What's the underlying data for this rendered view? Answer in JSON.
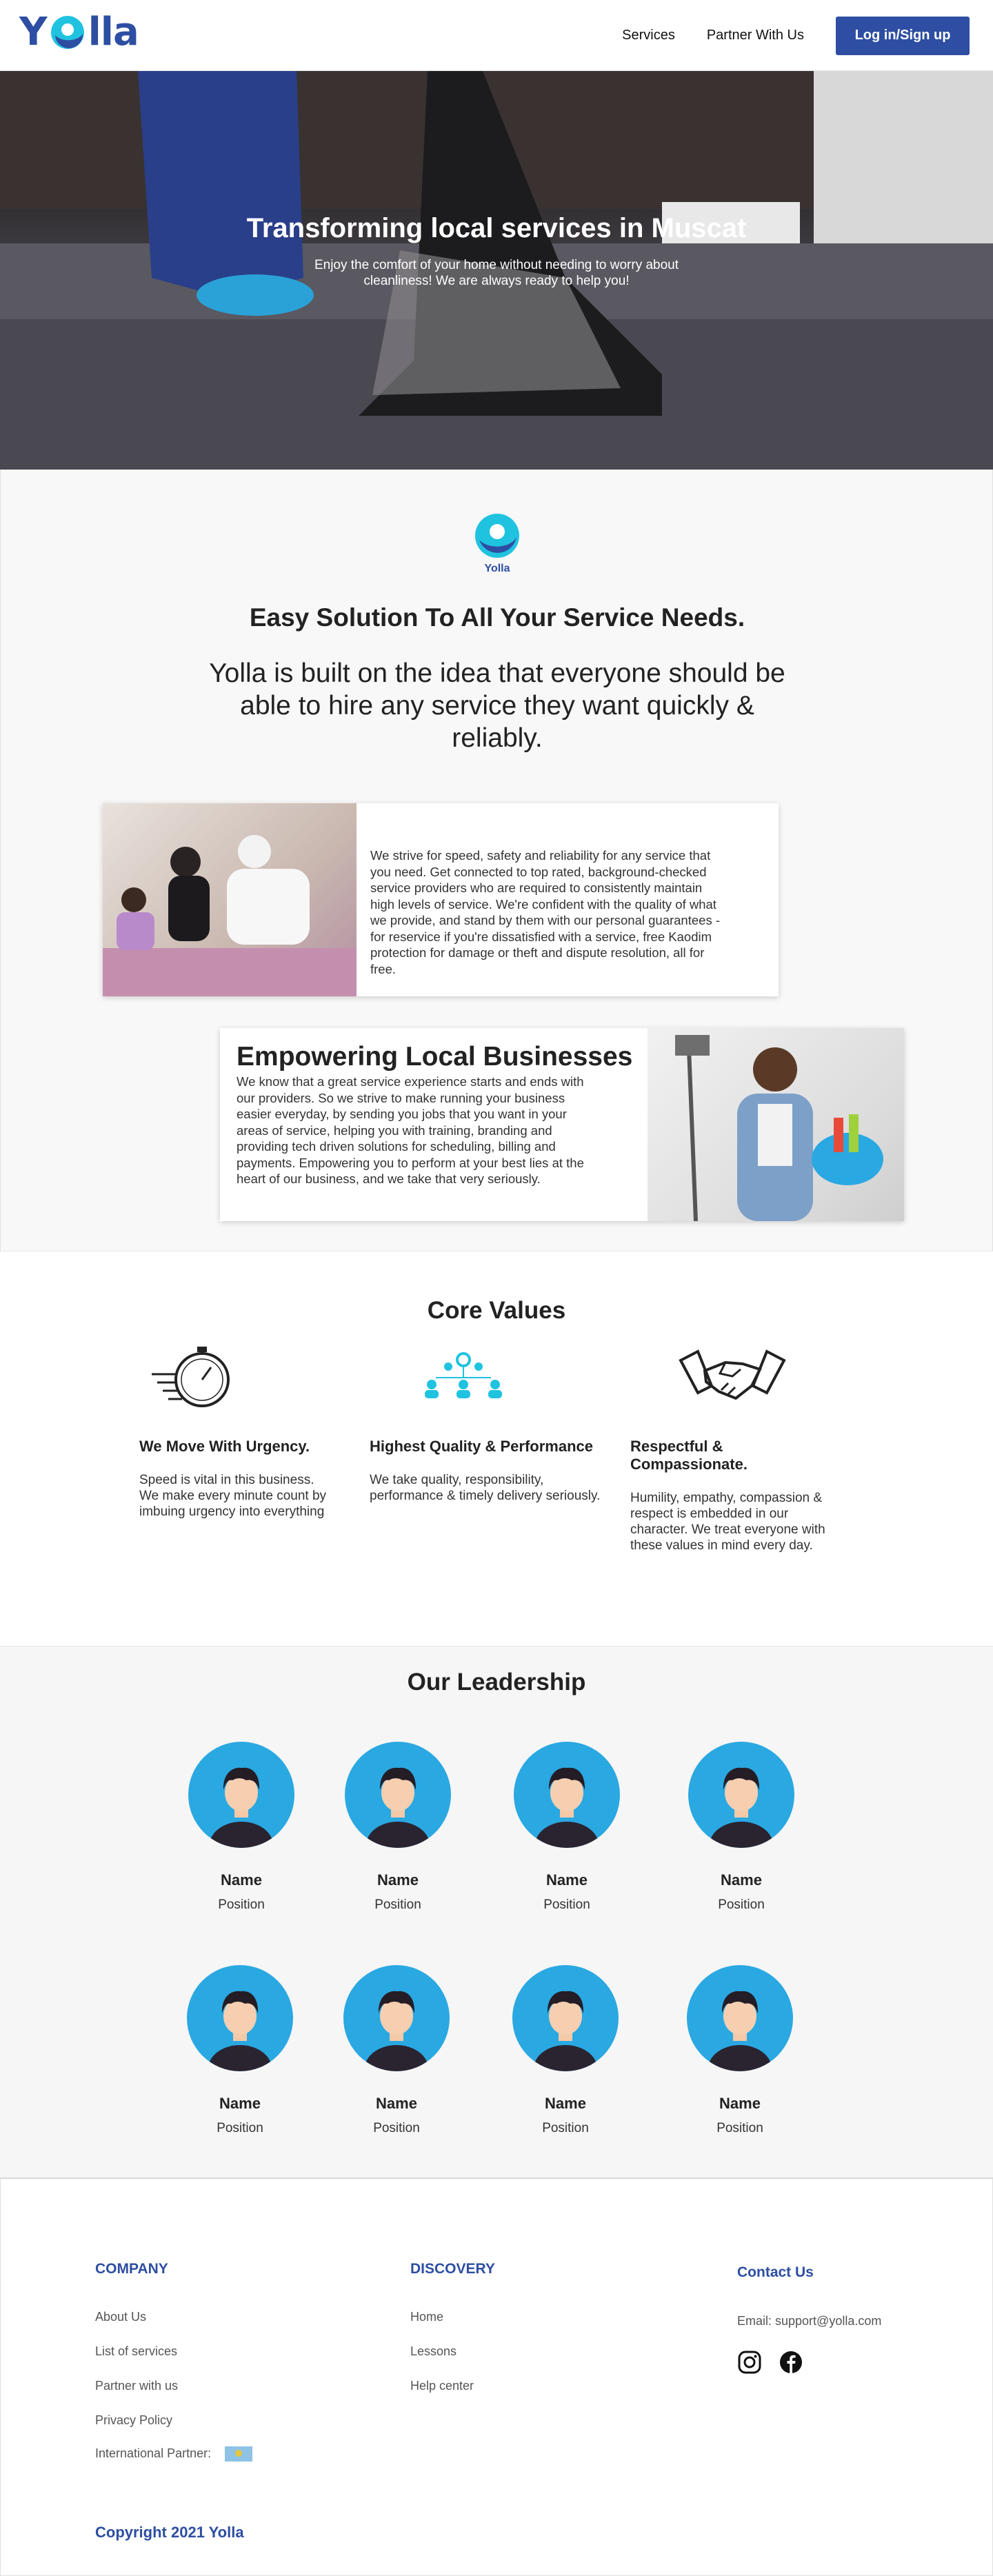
{
  "header": {
    "logo": "Yolla",
    "nav": [
      "Services",
      "Partner With Us"
    ],
    "login_label": "Log in/Sign up"
  },
  "hero": {
    "title": "Transforming local services in Muscat",
    "subtitle": "Enjoy the comfort of your home without needing to worry about cleanliness! We are always ready to help you!"
  },
  "intro": {
    "logo_caption": "Yolla",
    "heading": "Easy Solution To All Your Service Needs.",
    "paragraph": "Yolla is built on the idea that everyone should be able to hire any service they want quickly & reliably.",
    "card1_text": "We strive for speed, safety and reliability for any service that you need. Get connected to top rated, background-checked service providers who are required to consistently maintain high levels of service. We're confident with the quality of what we provide, and stand by them with our personal guarantees - for reservice if you're dissatisfied with a service, free Kaodim protection for damage or theft and dispute resolution, all for free.",
    "card2_title": "Empowering Local Businesses",
    "card2_text": "We know that a great service experience starts and ends with our providers. So we strive to make running your business easier everyday, by sending you jobs that you want in your areas of service, helping you with training, branding and providing tech driven solutions for scheduling, billing and payments. Empowering you to perform at your best lies at the heart of our business, and we take that very seriously."
  },
  "core_values": {
    "title": "Core Values",
    "items": [
      {
        "title": "We Move With Urgency.",
        "desc": "Speed is vital in this business. We make every minute count by imbuing urgency into everything",
        "icon": "stopwatch-icon"
      },
      {
        "title": "Highest Quality & Performance",
        "desc": "We take quality, responsibility, performance & timely delivery seriously.",
        "icon": "team-network-icon"
      },
      {
        "title": "Respectful & Compassionate.",
        "desc": "Humility, empathy, compassion & respect is embedded in our character. We treat everyone with these values in mind every day.",
        "icon": "handshake-icon"
      }
    ]
  },
  "leadership": {
    "title": "Our Leadership",
    "members": [
      {
        "name": "Name",
        "position": "Position"
      },
      {
        "name": "Name",
        "position": "Position"
      },
      {
        "name": "Name",
        "position": "Position"
      },
      {
        "name": "Name",
        "position": "Position"
      },
      {
        "name": "Name",
        "position": "Position"
      },
      {
        "name": "Name",
        "position": "Position"
      },
      {
        "name": "Name",
        "position": "Position"
      },
      {
        "name": "Name",
        "position": "Position"
      }
    ]
  },
  "footer": {
    "company_title": "COMPANY",
    "company_links": [
      "About Us",
      "List of services",
      "Partner with us",
      "Privacy Policy",
      "International Partner:"
    ],
    "discovery_title": "DISCOVERY",
    "discovery_links": [
      "Home",
      "Lessons",
      "Help center"
    ],
    "contact_title": "Contact Us",
    "email": "Email: support@yolla.com",
    "copyright": "Copyright 2021 Yolla"
  },
  "colors": {
    "brand_blue": "#2d4ea2",
    "avatar_blue": "#2aa8e2",
    "accent_cyan": "#1fc3e0"
  }
}
